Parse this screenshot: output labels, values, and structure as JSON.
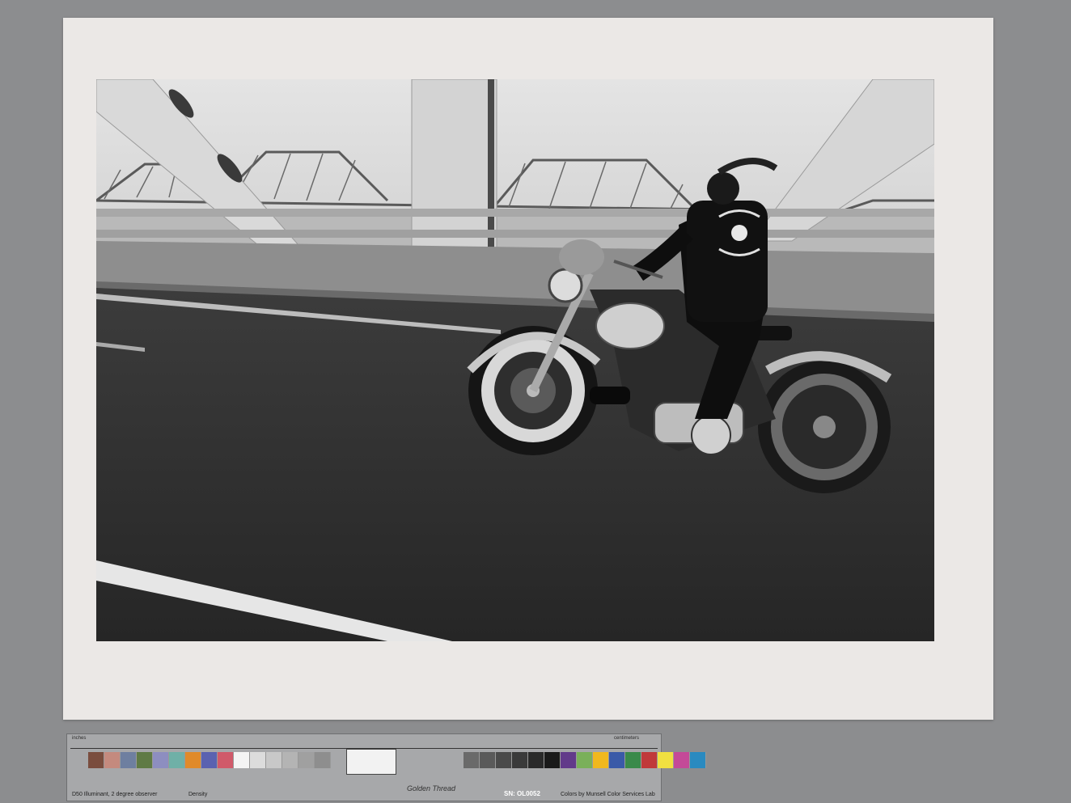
{
  "target": {
    "inches_label": "inches",
    "centimeters_label": "centimeters",
    "illuminant": "D50 Illuminant, 2 degree observer",
    "density_label": "Density",
    "brand": "Golden Thread",
    "serial": "SN: OL0052",
    "credit": "Colors by Munsell Color Services Lab",
    "patch_colors_left": [
      "#7a4d3e",
      "#c48a7e",
      "#6e7fa0",
      "#5f7a45",
      "#8d8ec0",
      "#6fb0a7",
      "#e08a2a",
      "#5a62b0",
      "#d05a6a",
      "#f4f4f4",
      "#dcdcdc",
      "#c8c8c8",
      "#b4b4b4",
      "#a0a0a0",
      "#8e8e8e"
    ],
    "patch_colors_right": [
      "#6a6a6a",
      "#5a5a5a",
      "#4a4a4a",
      "#3a3a3a",
      "#2a2a2a",
      "#1a1a1a",
      "#623a8a",
      "#7ab05a",
      "#f0b81e",
      "#3a5aa8",
      "#3a8a4a",
      "#c03a3a",
      "#f0e040",
      "#c44a98",
      "#2a8ac0"
    ]
  }
}
